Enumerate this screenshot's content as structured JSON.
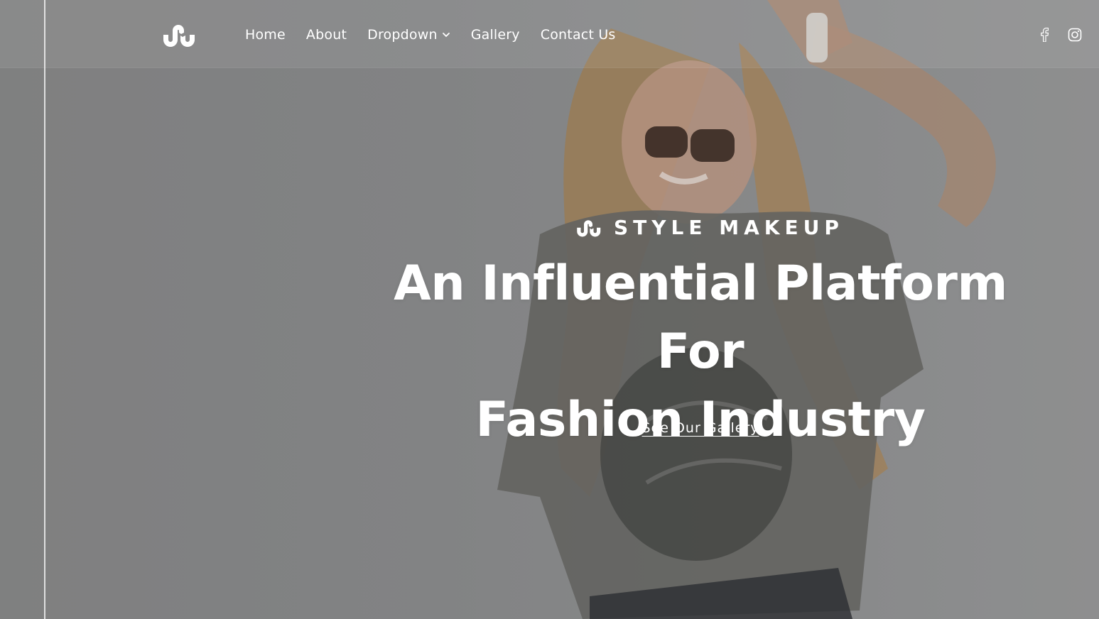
{
  "colors": {
    "background": "#8a8b8c",
    "text": "#ffffff",
    "header_overlay": "rgba(255,255,255,0.08)"
  },
  "header": {
    "logo_icon": "stumbleupon-icon",
    "nav": {
      "home": "Home",
      "about": "About",
      "dropdown": "Dropdown",
      "gallery": "Gallery",
      "contact": "Contact Us"
    },
    "social": {
      "facebook_icon": "facebook-icon",
      "instagram_icon": "instagram-icon"
    }
  },
  "hero": {
    "eyebrow": "STYLE MAKEUP",
    "headline_line1": "An Influential Platform For",
    "headline_line2": "Fashion Industry",
    "cta": "See Our Gallery"
  }
}
